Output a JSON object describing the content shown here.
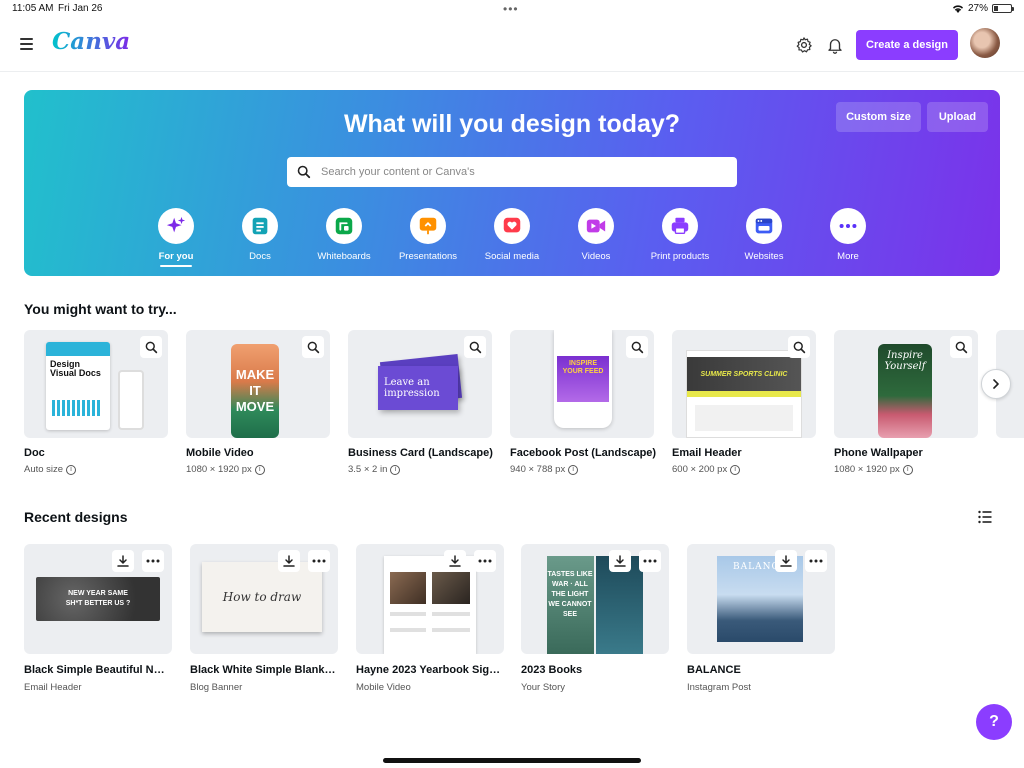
{
  "status_bar": {
    "time": "11:05 AM",
    "date": "Fri Jan 26",
    "battery": "27%",
    "battery_level": 0.27
  },
  "header": {
    "logo": "Canva",
    "create_button": "Create a design"
  },
  "hero": {
    "title": "What will you design today?",
    "custom_size": "Custom size",
    "upload": "Upload",
    "search_placeholder": "Search your content or Canva's",
    "categories": [
      {
        "label": "For you",
        "icon": "sparkle-icon",
        "color": "#7d2ae8"
      },
      {
        "label": "Docs",
        "icon": "doc-icon",
        "color": "#13a3b5"
      },
      {
        "label": "Whiteboards",
        "icon": "whiteboard-icon",
        "color": "#0ba84a"
      },
      {
        "label": "Presentations",
        "icon": "presentation-icon",
        "color": "#ff9100"
      },
      {
        "label": "Social media",
        "icon": "heart-icon",
        "color": "#ff3b4b"
      },
      {
        "label": "Videos",
        "icon": "video-icon",
        "color": "#c13ce8"
      },
      {
        "label": "Print products",
        "icon": "printer-icon",
        "color": "#8b3dff"
      },
      {
        "label": "Websites",
        "icon": "website-icon",
        "color": "#3d5cf5"
      },
      {
        "label": "More",
        "icon": "more-icon",
        "color": "#5a32fa"
      }
    ]
  },
  "try_section": {
    "title": "You might want to try...",
    "items": [
      {
        "name": "Doc",
        "sub": "Auto size",
        "thumb_text": "Design Visual Docs"
      },
      {
        "name": "Mobile Video",
        "sub": "1080 × 1920 px",
        "thumb_text": "MAKE IT MOVE"
      },
      {
        "name": "Business Card (Landscape)",
        "sub": "3.5 × 2 in",
        "thumb_text": "Leave an impression"
      },
      {
        "name": "Facebook Post (Landscape)",
        "sub": "940 × 788 px",
        "thumb_text": "INSPIRE YOUR FEED"
      },
      {
        "name": "Email Header",
        "sub": "600 × 200 px",
        "thumb_text": "SUMMER SPORTS CLINIC"
      },
      {
        "name": "Phone Wallpaper",
        "sub": "1080 × 1920 px",
        "thumb_text": "Inspire Yourself"
      }
    ]
  },
  "recent_section": {
    "title": "Recent designs",
    "items": [
      {
        "name": "Black Simple Beautiful Nat...",
        "type": "Email Header",
        "thumb_text": "NEW YEAR SAME SH*T BETTER US ?"
      },
      {
        "name": "Black White Simple Blank P...",
        "type": "Blog Banner",
        "thumb_text": "How to draw"
      },
      {
        "name": "Hayne 2023 Yearbook Sign...",
        "type": "Mobile Video"
      },
      {
        "name": "2023 Books",
        "type": "Your Story",
        "thumb_text": "TASTES LIKE WAR · ALL THE LIGHT WE CANNOT SEE"
      },
      {
        "name": "BALANCE",
        "type": "Instagram Post",
        "thumb_text": "BALANCE"
      }
    ]
  },
  "help": "?"
}
